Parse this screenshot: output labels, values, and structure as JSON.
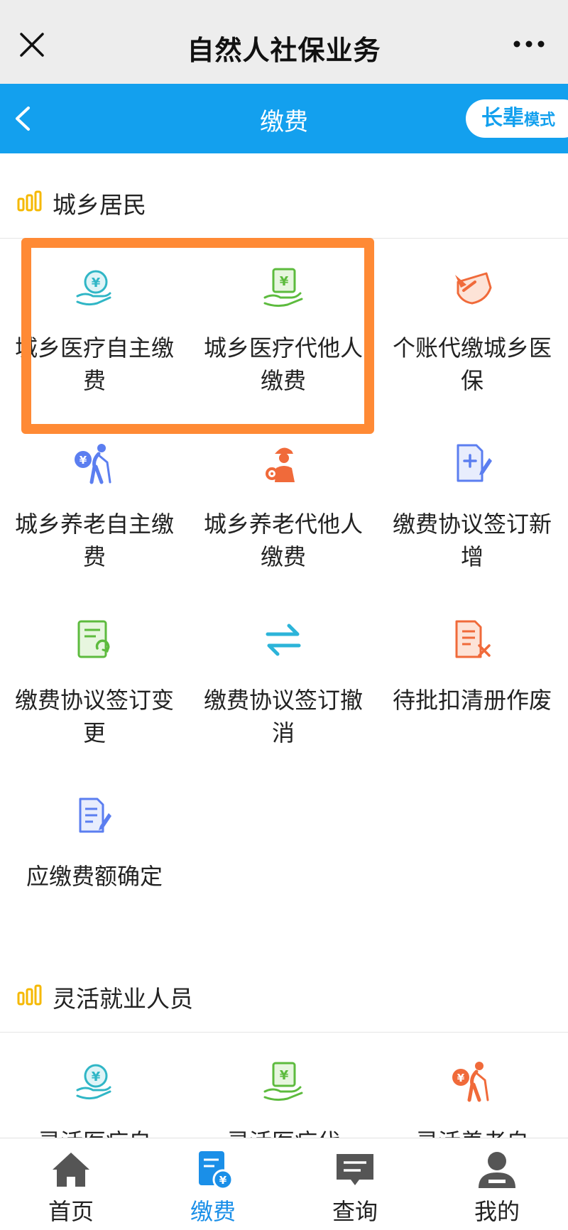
{
  "window": {
    "title": "自然人社保业务",
    "close_icon": "close-icon",
    "more_icon": "more-icon"
  },
  "header": {
    "title": "缴费",
    "back_icon": "chevron-left-icon",
    "elder_mode": {
      "big": "长辈",
      "small": "模式"
    }
  },
  "colors": {
    "header_bg": "#13a0ee",
    "highlight": "#ff8a35",
    "teal": "#30b6c6",
    "green": "#5dbb3e",
    "orange": "#f06a3a",
    "blue_purple": "#5b7ef0",
    "tab_active": "#1a8fe8"
  },
  "sections": [
    {
      "title": "城乡居民",
      "items": [
        {
          "label": "城乡医疗自主缴费",
          "icon": "hand-yuan-coin-icon"
        },
        {
          "label": "城乡医疗代他人缴费",
          "icon": "hand-yuan-bill-icon"
        },
        {
          "label": "个账代缴城乡医保",
          "icon": "pay-card-icon"
        },
        {
          "label": "城乡养老自主缴费",
          "icon": "elder-yuan-icon"
        },
        {
          "label": "城乡养老代他人缴费",
          "icon": "worker-gear-icon"
        },
        {
          "label": "缴费协议签订新增",
          "icon": "document-add-icon"
        },
        {
          "label": "缴费协议签订变更",
          "icon": "document-refresh-icon"
        },
        {
          "label": "缴费协议签订撤消",
          "icon": "arrows-exchange-icon"
        },
        {
          "label": "待批扣清册作废",
          "icon": "document-cancel-icon"
        },
        {
          "label": "应缴费额确定",
          "icon": "document-edit-icon"
        }
      ]
    },
    {
      "title": "灵活就业人员",
      "items": [
        {
          "label": "灵活医疗自",
          "icon": "hand-yuan-coin-icon"
        },
        {
          "label": "灵活医疗代",
          "icon": "hand-yuan-bill-icon"
        },
        {
          "label": "灵活养老自",
          "icon": "elder-yuan-icon"
        }
      ]
    }
  ],
  "tabs": [
    {
      "label": "首页",
      "icon": "home-icon",
      "active": false
    },
    {
      "label": "缴费",
      "icon": "bill-yuan-icon",
      "active": true
    },
    {
      "label": "查询",
      "icon": "message-icon",
      "active": false
    },
    {
      "label": "我的",
      "icon": "user-icon",
      "active": false
    }
  ]
}
